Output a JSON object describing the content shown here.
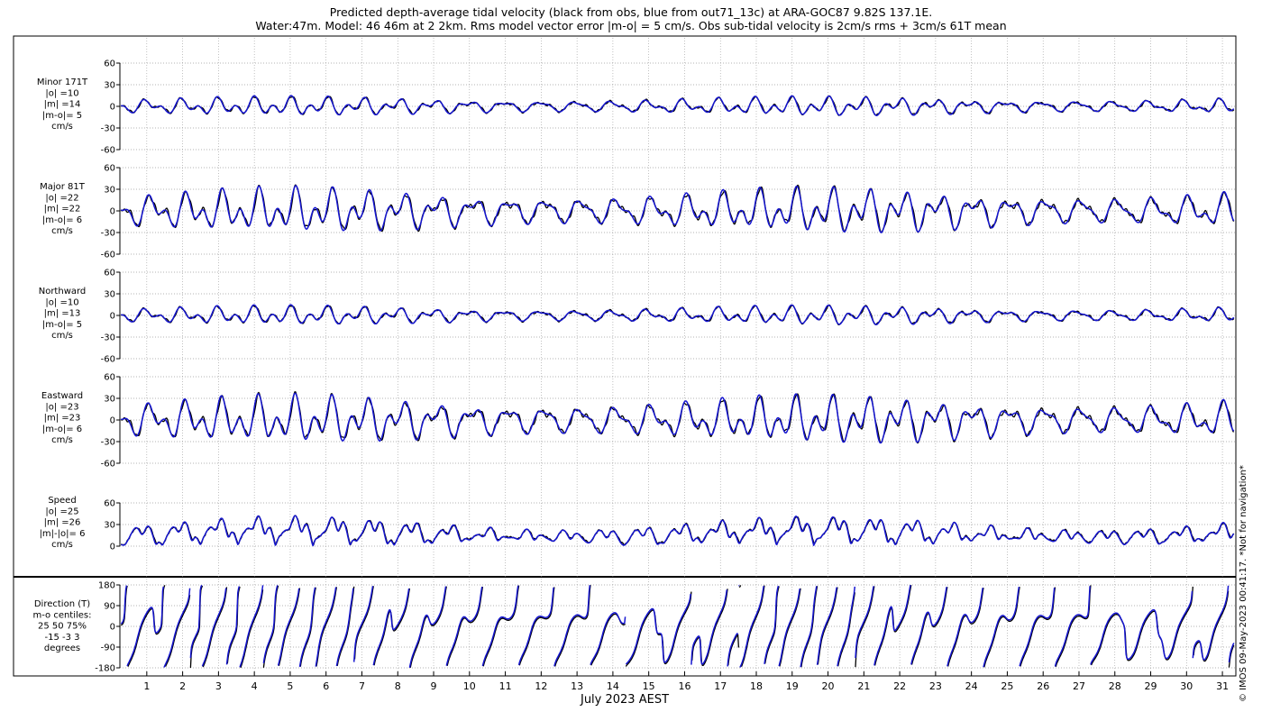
{
  "title": {
    "line1": "Predicted depth-average tidal velocity (black from obs, blue from out71_13c) at ARA-GOC87 9.82S 137.1E.",
    "line2": "Water:47m. Model: 46 46m at 2 2km. Rms model vector error |m-o| = 5 cm/s. Obs sub-tidal velocity is 2cm/s rms + 3cm/s 61T mean"
  },
  "xlabel": "July 2023 AEST",
  "credit": "© IMOS 09-May-2023 00:41:17. *Not for navigation*",
  "colors": {
    "obs": "#000000",
    "model": "#1515d0",
    "grid": "#9a9a9a"
  },
  "chart_data": [
    {
      "type": "line",
      "name": "minor",
      "ylim": [
        -60,
        60
      ],
      "yticks": [
        -60,
        -30,
        0,
        30,
        60
      ],
      "ylabel": [
        "Minor 171T",
        "|o| =10",
        "|m| =14",
        "|m-o|= 5",
        "cm/s"
      ],
      "amplitude": 16,
      "series": [
        {
          "name": "obs",
          "color": "#000000"
        },
        {
          "name": "model",
          "color": "#1515d0"
        }
      ]
    },
    {
      "type": "line",
      "name": "major",
      "ylim": [
        -60,
        60
      ],
      "yticks": [
        -60,
        -30,
        0,
        30,
        60
      ],
      "ylabel": [
        "Major 81T",
        "|o| =22",
        "|m| =22",
        "|m-o|= 6",
        "cm/s"
      ],
      "amplitude": 34,
      "series": [
        {
          "name": "obs",
          "color": "#000000"
        },
        {
          "name": "model",
          "color": "#1515d0"
        }
      ]
    },
    {
      "type": "line",
      "name": "northward",
      "ylim": [
        -60,
        60
      ],
      "yticks": [
        -60,
        -30,
        0,
        30,
        60
      ],
      "ylabel": [
        "Northward",
        "|o| =10",
        "|m| =13",
        "|m-o|= 5",
        "cm/s"
      ],
      "amplitude": 16,
      "series": [
        {
          "name": "obs",
          "color": "#000000"
        },
        {
          "name": "model",
          "color": "#1515d0"
        }
      ]
    },
    {
      "type": "line",
      "name": "eastward",
      "ylim": [
        -60,
        60
      ],
      "yticks": [
        -60,
        -30,
        0,
        30,
        60
      ],
      "ylabel": [
        "Eastward",
        "|o| =23",
        "|m| =23",
        "|m-o|= 6",
        "cm/s"
      ],
      "amplitude": 36,
      "series": [
        {
          "name": "obs",
          "color": "#000000"
        },
        {
          "name": "model",
          "color": "#1515d0"
        }
      ]
    },
    {
      "type": "line",
      "name": "speed",
      "ylim": [
        0,
        60
      ],
      "yticks": [
        0,
        30,
        60
      ],
      "ylabel": [
        "Speed",
        "|o| =25",
        "|m| =26",
        "|m|-|o|= 6",
        "cm/s"
      ],
      "amplitude": 40,
      "series": [
        {
          "name": "obs",
          "color": "#000000"
        },
        {
          "name": "model",
          "color": "#1515d0"
        }
      ]
    },
    {
      "type": "line",
      "name": "direction",
      "ylim": [
        -180,
        180
      ],
      "yticks": [
        -180,
        -90,
        0,
        90,
        180
      ],
      "ylabel": [
        "Direction (T)",
        "m-o centiles:",
        "25  50  75%",
        "-15  -3   3",
        "degrees"
      ],
      "series": [
        {
          "name": "obs",
          "color": "#000000"
        },
        {
          "name": "model",
          "color": "#1515d0"
        }
      ]
    }
  ],
  "x_axis": {
    "days": [
      "1",
      "2",
      "3",
      "4",
      "5",
      "6",
      "7",
      "8",
      "9",
      "10",
      "11",
      "12",
      "13",
      "14",
      "15",
      "16",
      "17",
      "18",
      "19",
      "20",
      "21",
      "22",
      "23",
      "24",
      "25",
      "26",
      "27",
      "28",
      "29",
      "30",
      "31"
    ]
  }
}
